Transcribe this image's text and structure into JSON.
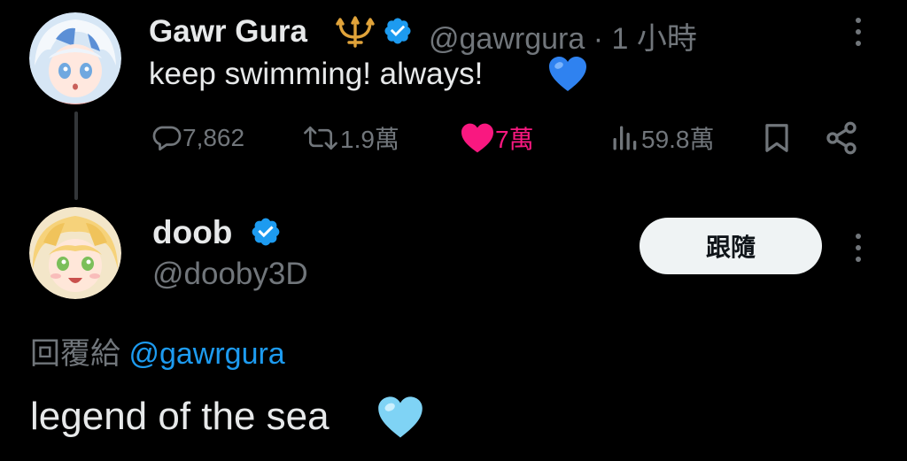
{
  "tweet1": {
    "display_name": "Gawr Gura",
    "handle": "@gawrgura",
    "separator": "·",
    "time": "1 小時",
    "text": "keep swimming! always!",
    "text_emoji": "blue-heart",
    "replies": "7,862",
    "retweets": "1.9萬",
    "likes": "7萬",
    "views": "59.8萬",
    "name_emblem_icon": "trident-icon",
    "liked": true
  },
  "tweet2": {
    "display_name": "doob",
    "handle": "@dooby3D",
    "follow_label": "跟隨",
    "reply_to_prefix": "回覆給",
    "reply_to_handle": "@gawrgura",
    "text": "legend of the sea",
    "text_emoji": "light-blue-heart"
  },
  "colors": {
    "background": "#000000",
    "text": "#e7e9ea",
    "muted": "#71767b",
    "link": "#1d9bf0",
    "like": "#f91880",
    "verified": "#1d9bf0",
    "trident": "#e0a33a"
  }
}
